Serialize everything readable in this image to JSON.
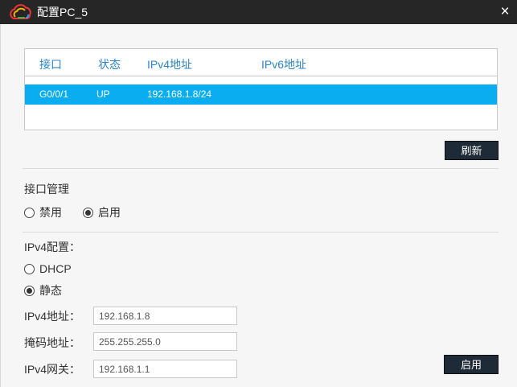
{
  "window": {
    "title": "配置PC_5",
    "close_glyph": "×",
    "logo_icon": "cloud-logo-icon"
  },
  "table": {
    "headers": [
      "接口",
      "状态",
      "IPv4地址",
      "IPv6地址"
    ],
    "rows": [
      {
        "interface": "G0/0/1",
        "status": "UP",
        "ipv4": "192.168.1.8/24",
        "ipv6": ""
      }
    ],
    "selected_row_color": "#0aadf0"
  },
  "refresh_button": "刷新",
  "interface_mgmt": {
    "title": "接口管理",
    "options": [
      {
        "label": "禁用",
        "checked": false
      },
      {
        "label": "启用",
        "checked": true
      }
    ]
  },
  "ipv4_config": {
    "title": "IPv4配置：",
    "options": [
      {
        "label": "DHCP",
        "checked": false
      },
      {
        "label": "静态",
        "checked": true
      }
    ],
    "fields": [
      {
        "label": "IPv4地址：",
        "value": "192.168.1.8"
      },
      {
        "label": "掩码地址：",
        "value": "255.255.255.0"
      },
      {
        "label": "IPv4网关：",
        "value": "192.168.1.1"
      }
    ]
  },
  "apply_button": "启用"
}
